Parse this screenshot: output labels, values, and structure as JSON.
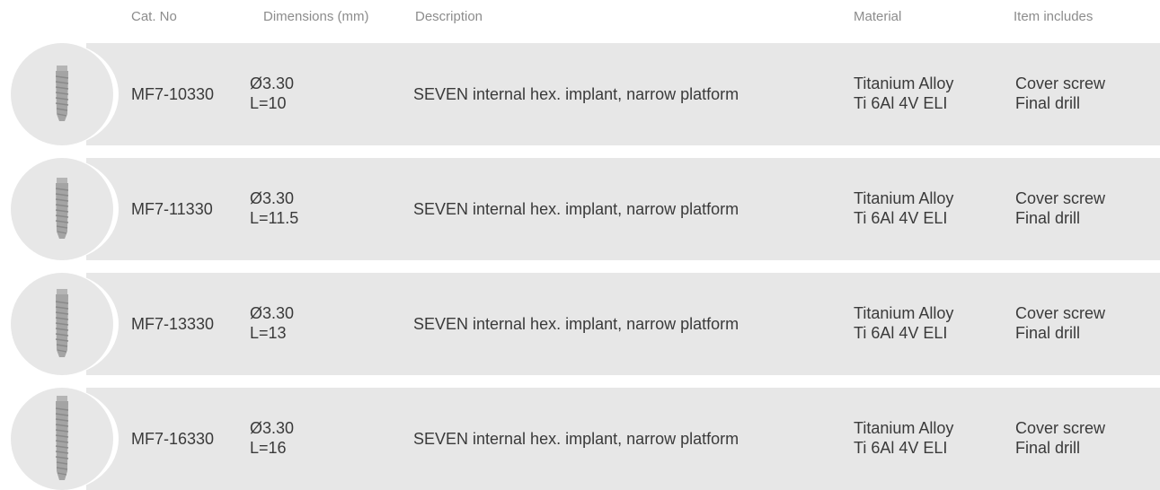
{
  "headers": {
    "cat_no": "Cat. No",
    "dimensions": "Dimensions (mm)",
    "description": "Description",
    "material": "Material",
    "item_includes": "Item includes"
  },
  "rows": [
    {
      "cat_no": "MF7-10330",
      "diameter": "Ø3.30",
      "length": "L=10",
      "description": "SEVEN internal hex. implant, narrow platform",
      "material_1": "Titanium Alloy",
      "material_2": "Ti 6Al 4V ELI",
      "includes_1": "Cover screw",
      "includes_2": "Final drill"
    },
    {
      "cat_no": "MF7-11330",
      "diameter": "Ø3.30",
      "length": "L=11.5",
      "description": "SEVEN internal hex. implant, narrow platform",
      "material_1": "Titanium Alloy",
      "material_2": "Ti 6Al 4V ELI",
      "includes_1": "Cover screw",
      "includes_2": "Final drill"
    },
    {
      "cat_no": "MF7-13330",
      "diameter": "Ø3.30",
      "length": "L=13",
      "description": "SEVEN internal hex. implant, narrow platform",
      "material_1": "Titanium Alloy",
      "material_2": "Ti 6Al 4V ELI",
      "includes_1": "Cover screw",
      "includes_2": "Final drill"
    },
    {
      "cat_no": "MF7-16330",
      "diameter": "Ø3.30",
      "length": "L=16",
      "description": "SEVEN internal hex. implant, narrow platform",
      "material_1": "Titanium Alloy",
      "material_2": "Ti 6Al 4V ELI",
      "includes_1": "Cover screw",
      "includes_2": "Final drill"
    }
  ],
  "colors": {
    "row_background": "#e7e7e7",
    "header_text": "#8c8c8c",
    "body_text": "#3a3a3a"
  }
}
